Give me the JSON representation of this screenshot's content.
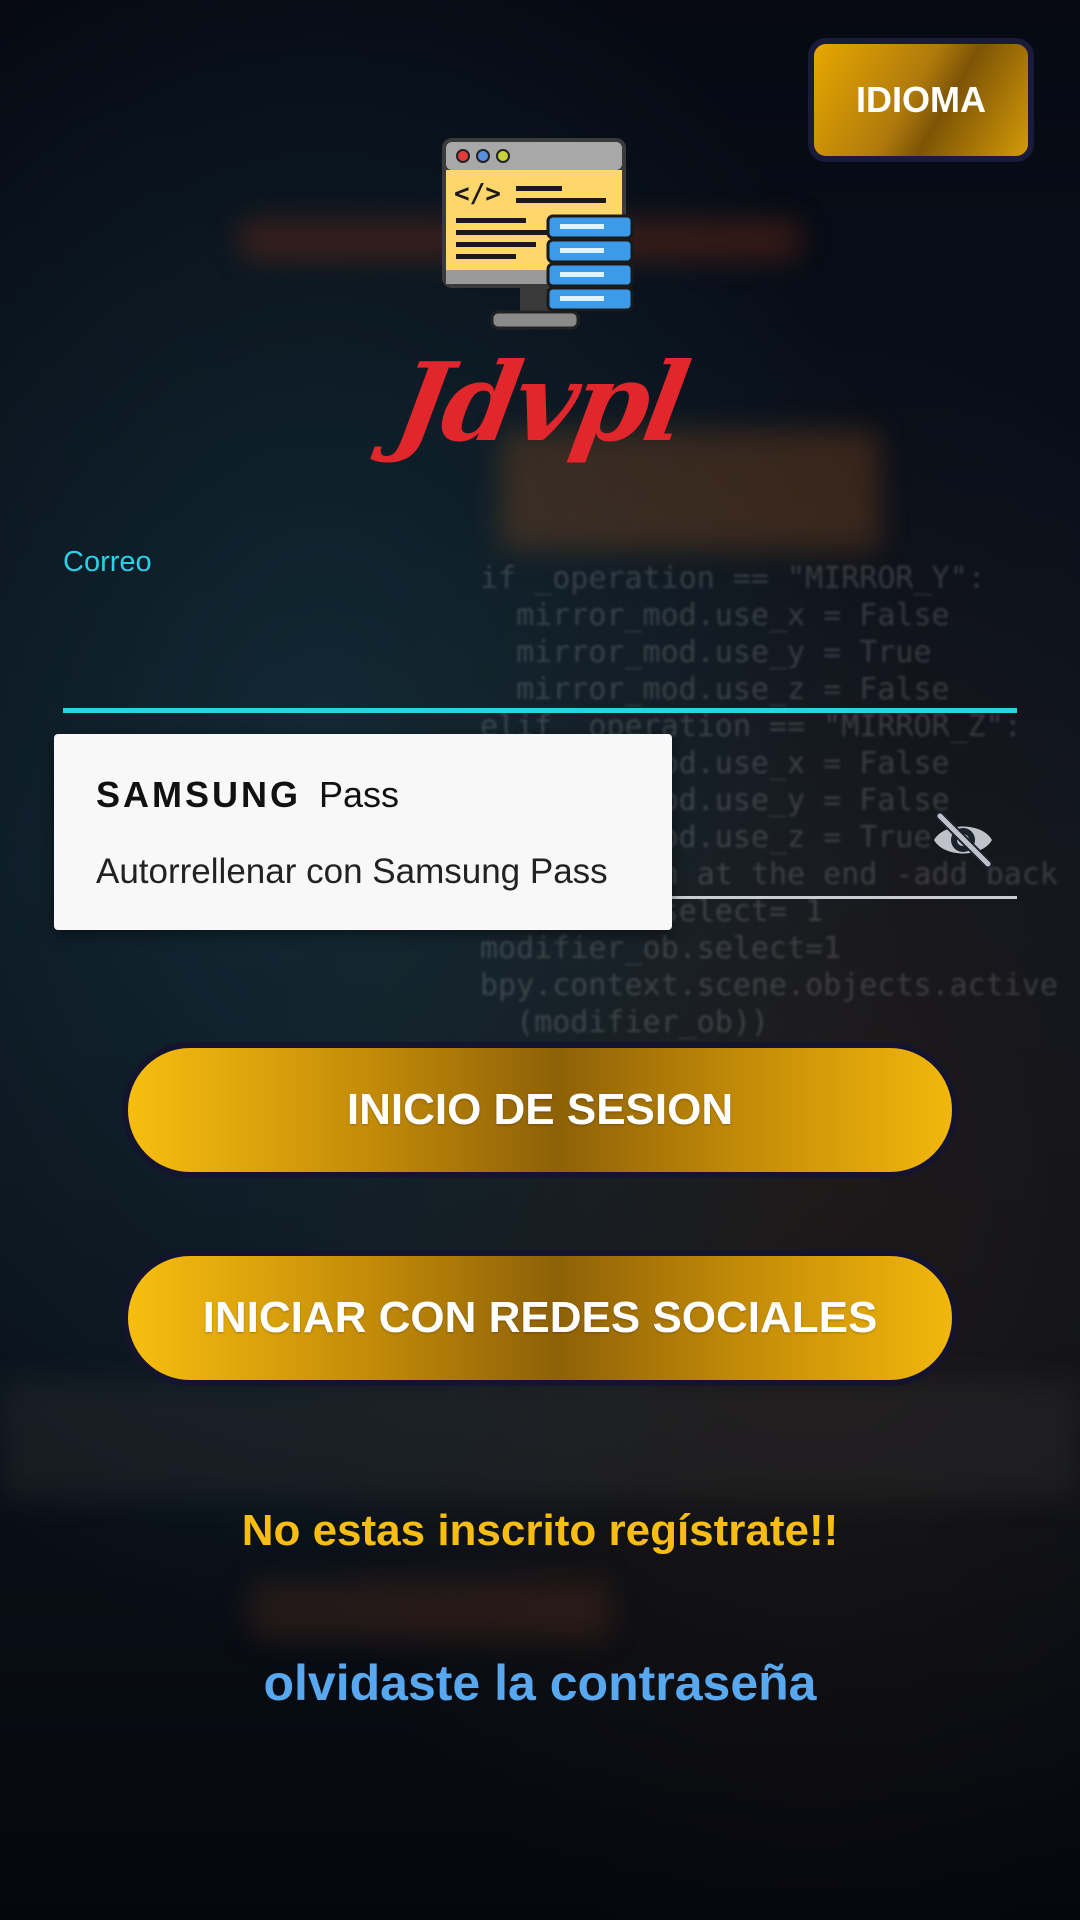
{
  "header": {
    "language_button": "IDIOMA",
    "brand": "Jdvpl"
  },
  "form": {
    "email_label": "Correo",
    "email_value": "",
    "password_value": ""
  },
  "autofill_popup": {
    "brand_samsung": "SAMSUNG",
    "brand_pass": "Pass",
    "action_text": "Autorrellenar con Samsung Pass"
  },
  "actions": {
    "login_label": "INICIO DE SESION",
    "social_login_label": "INICIAR CON REDES SOCIALES",
    "register_link": "No estas inscrito regístrate!!",
    "forgot_password_link": "olvidaste la contraseña"
  },
  "icons": {
    "logo": "code-monitor-database-icon",
    "password_toggle": "eye-off-icon"
  },
  "colors": {
    "accent_cyan": "#2bd2e3",
    "button_gold": "#f7be10",
    "brand_red": "#e1262c",
    "register_yellow": "#f7bd12",
    "forgot_blue": "#58a8ef"
  }
}
